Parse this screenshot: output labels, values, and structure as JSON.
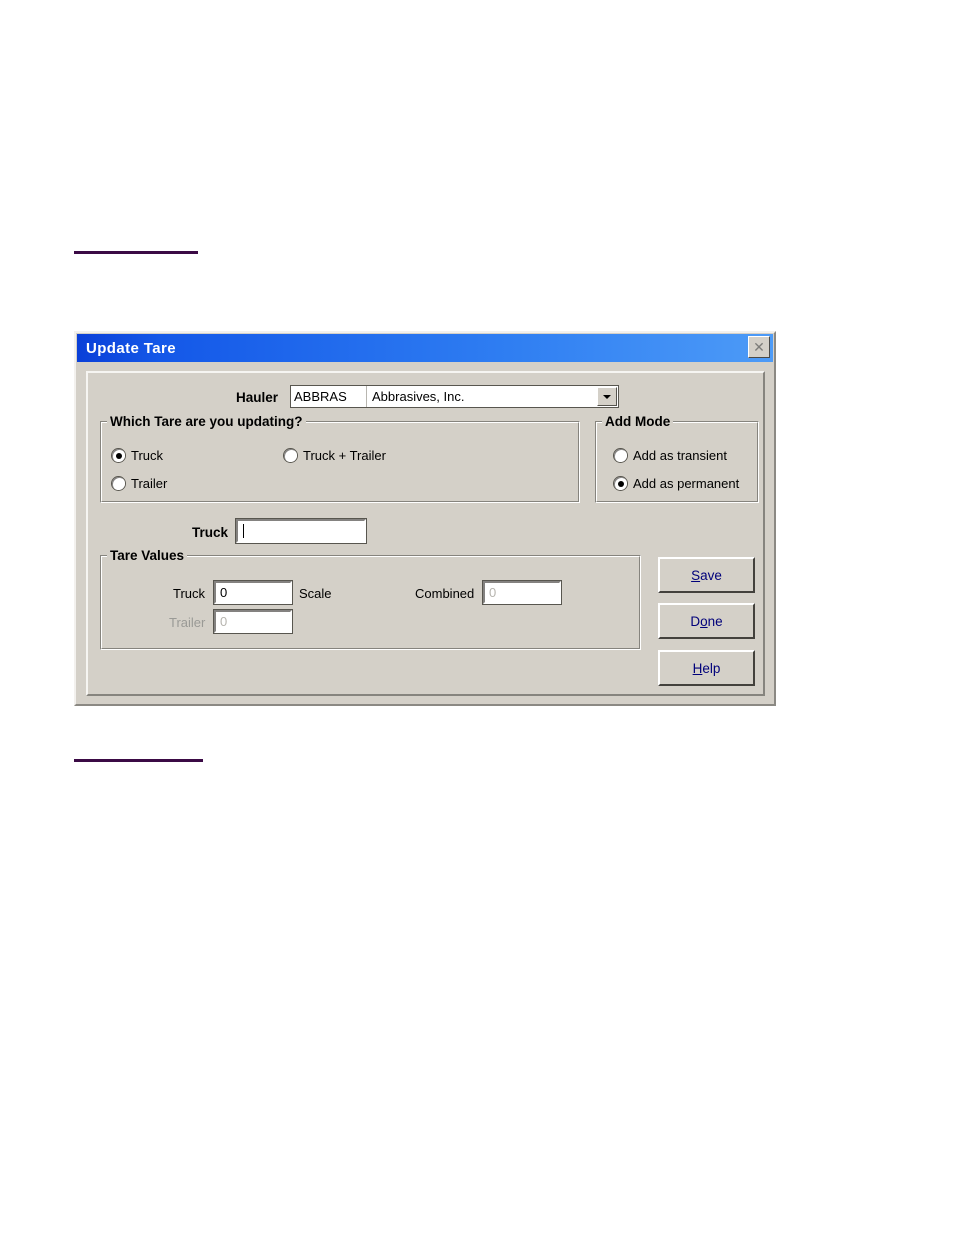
{
  "page": {
    "background": "#ffffff",
    "rules": [
      {
        "name": "top-rule",
        "color": "#3b0a45"
      },
      {
        "name": "bottom-rule",
        "color": "#3b0a45"
      }
    ]
  },
  "dialog": {
    "title": "Update Tare",
    "titlebar_color_left": "#0a3fd8",
    "titlebar_color_right": "#4d9bf7",
    "face_color": "#d4d0c8",
    "close_button": "✕",
    "close_icon_name": "close-icon"
  },
  "hauler": {
    "label": "Hauler",
    "code": "ABBRAS",
    "name": "Abbrasives, Inc.",
    "dropdown_icon": "chevron-down-icon"
  },
  "which_tare": {
    "title": "Which Tare are you updating?",
    "options": [
      {
        "label": "Truck",
        "checked": true
      },
      {
        "label": "Truck + Trailer",
        "checked": false
      },
      {
        "label": "Trailer",
        "checked": false
      }
    ]
  },
  "add_mode": {
    "title": "Add Mode",
    "options": [
      {
        "label": "Add as transient",
        "checked": false
      },
      {
        "label": "Add as permanent",
        "checked": true
      }
    ]
  },
  "truck_entry": {
    "label": "Truck",
    "value": "",
    "focused": true
  },
  "tare_values": {
    "title": "Tare Values",
    "truck_label": "Truck",
    "truck_value": "0",
    "truck_enabled": true,
    "scale_label": "Scale",
    "trailer_label": "Trailer",
    "trailer_value": "0",
    "trailer_enabled": false,
    "combined_label": "Combined",
    "combined_value": "0",
    "combined_enabled": false
  },
  "buttons": {
    "save": {
      "pre": "",
      "accel": "S",
      "post": "ave"
    },
    "done": {
      "pre": "D",
      "accel": "o",
      "post": "ne"
    },
    "help": {
      "pre": "",
      "accel": "H",
      "post": "elp"
    },
    "text_color": "#00007a"
  }
}
